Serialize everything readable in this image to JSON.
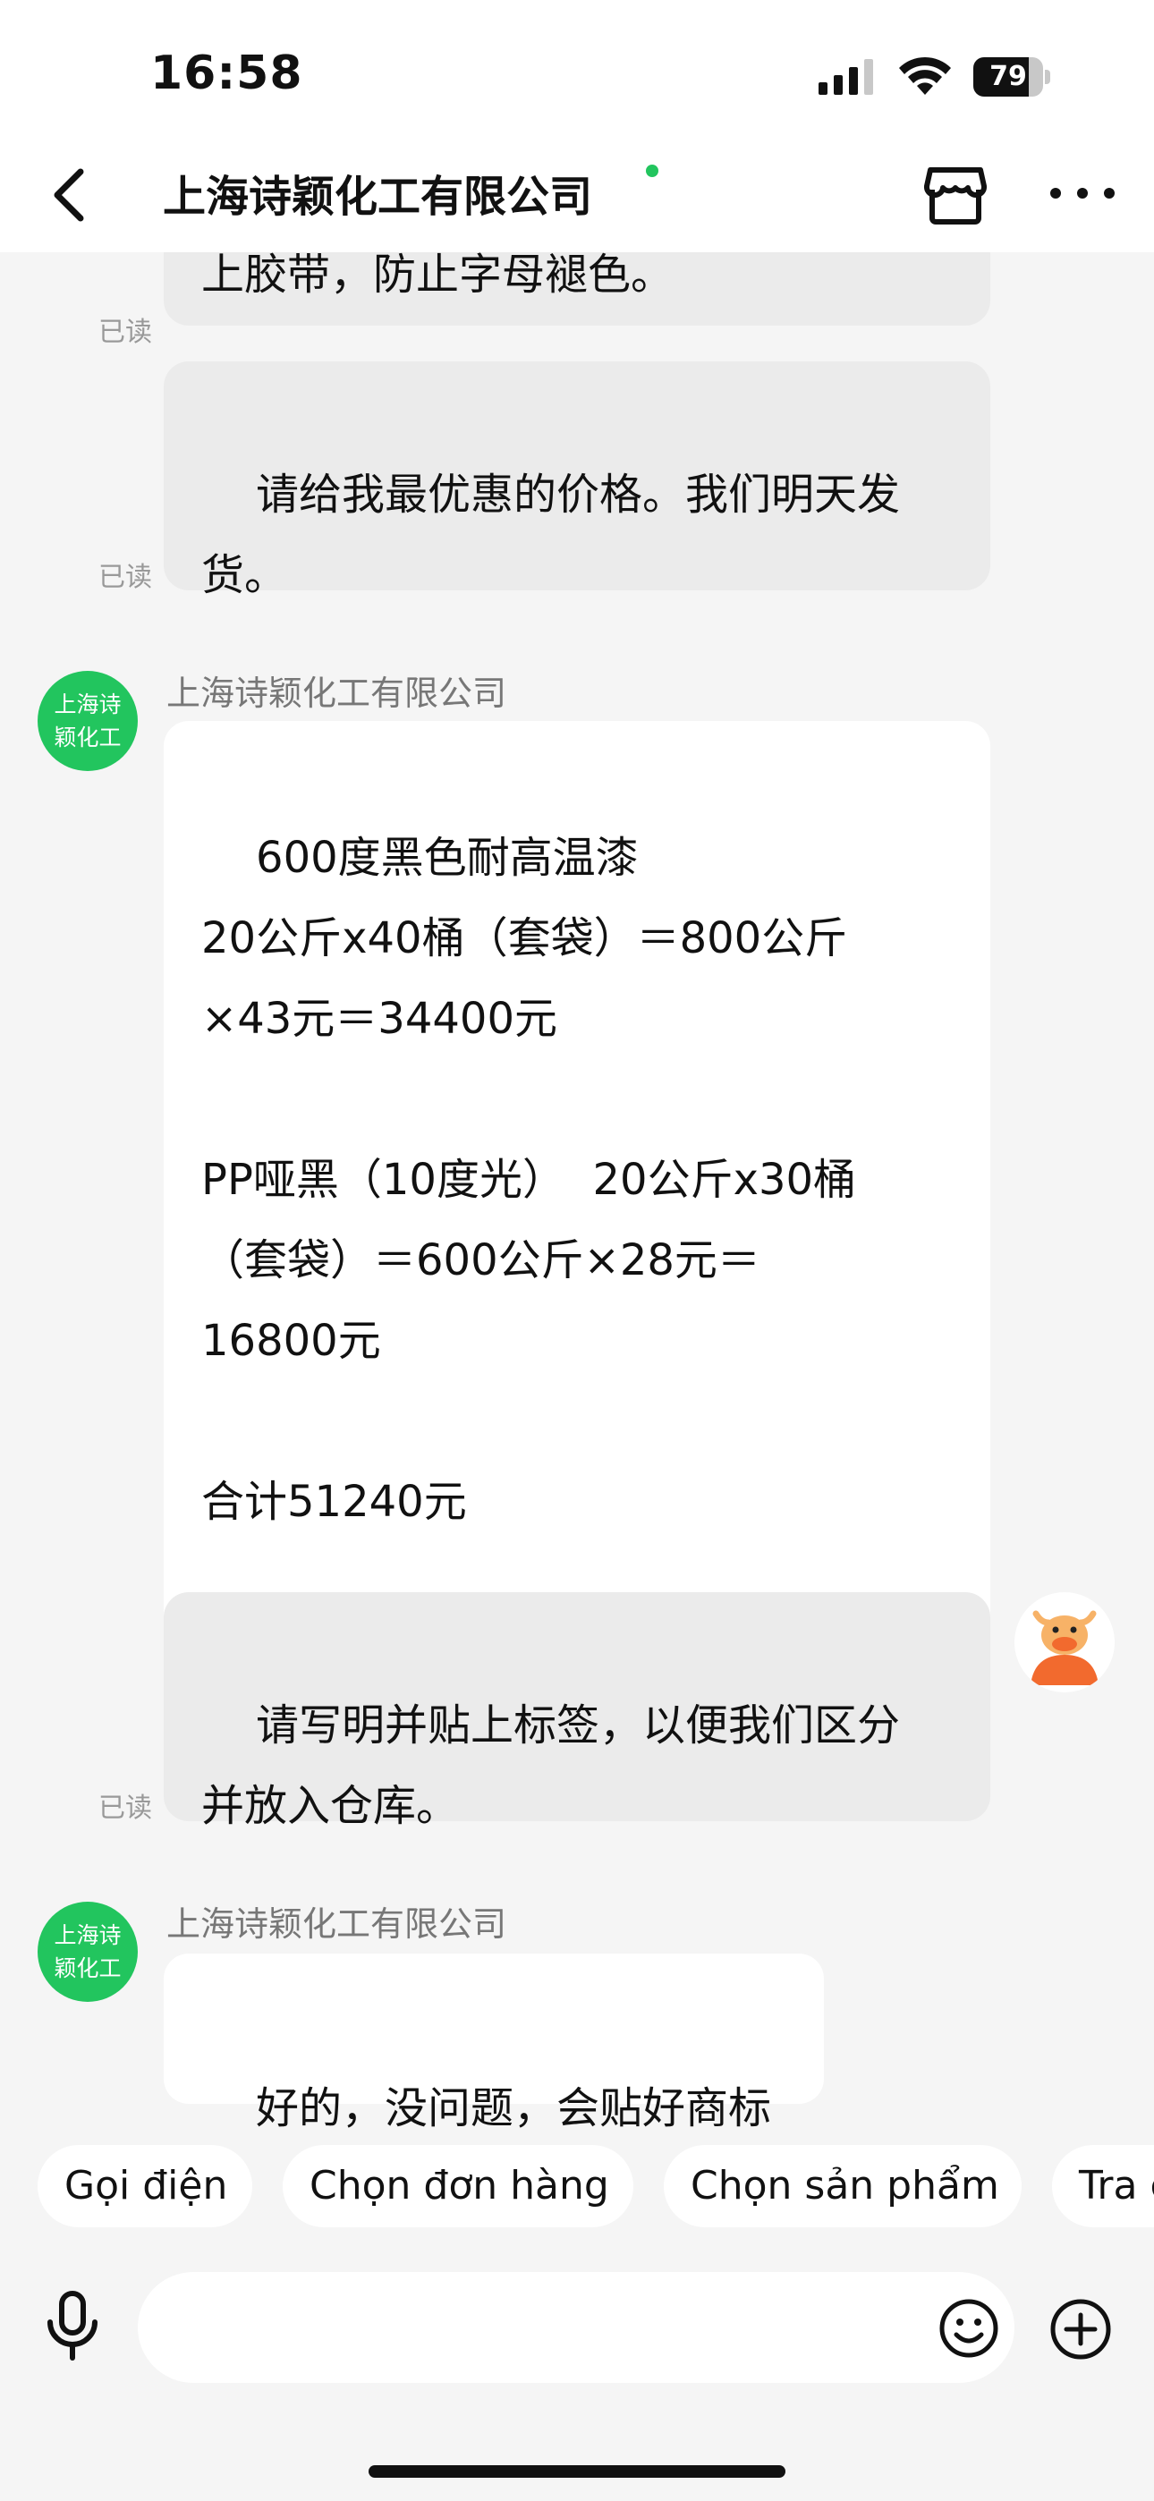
{
  "status_bar": {
    "time": "16:58",
    "battery": "79",
    "battery_level": 0.79
  },
  "header": {
    "title": "上海诗颖化工有限公司",
    "online": true
  },
  "messages": [
    {
      "text": "上胶带，防止字母褪色。",
      "read": "已读"
    },
    {
      "text": "请给我最优惠的价格。我们明天发\n货。",
      "read": "已读"
    },
    {
      "avatar": "上海诗\n颖化工",
      "sender": "上海诗颖化工有限公司",
      "text": "600度黑色耐高温漆\n20公斤x40桶（套袋）＝800公斤\n×43元＝34400元\n\nPP哑黑（10度光）  20公斤x30桶\n（套袋）＝600公斤×28元＝\n16800元\n\n合计51240元"
    },
    {
      "text": "请写明并贴上标签，以便我们区分\n并放入仓库。",
      "read": "已读"
    },
    {
      "avatar": "上海诗\n颖化工",
      "sender": "上海诗颖化工有限公司",
      "text": "好的，没问题，会贴好商标"
    }
  ],
  "quick_actions": [
    "Gọi điện",
    "Chọn đơn hàng",
    "Chọn sản phẩm",
    "Tra c"
  ],
  "input": {
    "value": "",
    "placeholder": ""
  },
  "icons": {
    "back": "chevron-left-icon",
    "store": "store-icon",
    "more": "more-dots-icon",
    "mic": "microphone-icon",
    "emoji": "emoji-icon",
    "plus": "plus-circle-icon"
  },
  "colors": {
    "accent_green": "#22c55e",
    "background": "#f5f5f5"
  }
}
